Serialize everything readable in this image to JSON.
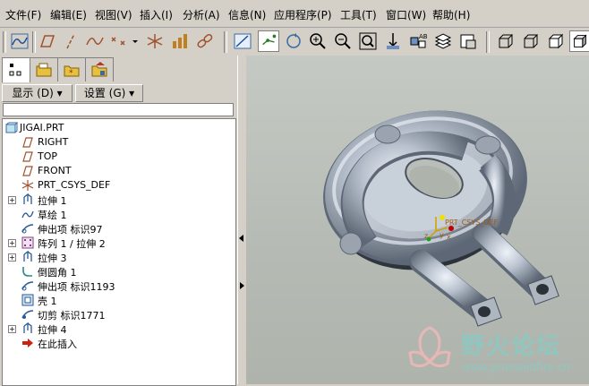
{
  "menubar": {
    "items": [
      {
        "label": "文件(F)"
      },
      {
        "label": "编辑(E)"
      },
      {
        "label": "视图(V)"
      },
      {
        "label": "插入(I)"
      },
      {
        "label": "分析(A)"
      },
      {
        "label": "信息(N)"
      },
      {
        "label": "应用程序(P)"
      },
      {
        "label": "工具(T)"
      },
      {
        "label": "窗口(W)"
      },
      {
        "label": "帮助(H)"
      }
    ]
  },
  "panel": {
    "show_label": "显示 (D) ▾",
    "settings_label": "设置 (G) ▾"
  },
  "tree": {
    "items": [
      {
        "label": "JIGAI.PRT"
      },
      {
        "label": "RIGHT"
      },
      {
        "label": "TOP"
      },
      {
        "label": "FRONT"
      },
      {
        "label": "PRT_CSYS_DEF"
      },
      {
        "label": "拉伸 1"
      },
      {
        "label": "草绘 1"
      },
      {
        "label": "伸出项 标识97"
      },
      {
        "label": "阵列 1 / 拉伸 2"
      },
      {
        "label": "拉伸 3"
      },
      {
        "label": "倒圆角 1"
      },
      {
        "label": "伸出项 标识1193"
      },
      {
        "label": "壳 1"
      },
      {
        "label": "切剪 标识1771"
      },
      {
        "label": "拉伸 4"
      },
      {
        "label": "在此插入"
      }
    ]
  },
  "viewport": {
    "csys_label": "PRT_CSYS_DEF",
    "axis_x": "x",
    "axis_y": "y",
    "axis_z": "z"
  },
  "watermark": {
    "title": "野火论坛",
    "url": "www.proewildfire.cn"
  }
}
